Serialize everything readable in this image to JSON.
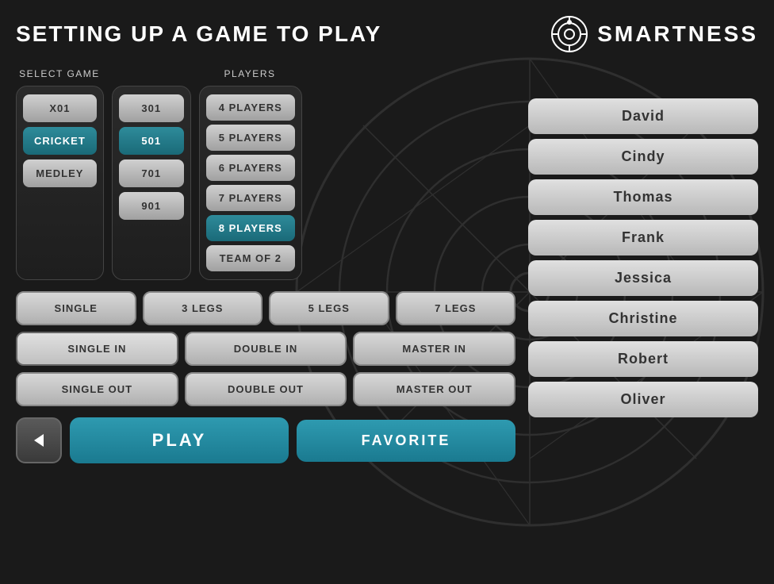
{
  "header": {
    "title": "SETTING UP A GAME TO PLAY",
    "logo_text": "SMARTNESS"
  },
  "select_game": {
    "label": "SELECT GAME",
    "game_types": [
      {
        "id": "x01",
        "label": "X01",
        "active": false
      },
      {
        "id": "cricket",
        "label": "CRICKET",
        "active": true
      },
      {
        "id": "medley",
        "label": "MEDLEY",
        "active": false
      }
    ],
    "scores": [
      {
        "id": "301",
        "label": "301",
        "active": false
      },
      {
        "id": "501",
        "label": "501",
        "active": true
      },
      {
        "id": "701",
        "label": "701",
        "active": false
      },
      {
        "id": "901",
        "label": "901",
        "active": false
      }
    ]
  },
  "players_section": {
    "label": "PLAYERS",
    "options": [
      {
        "id": "4players",
        "label": "4 PLAYERS",
        "active": false
      },
      {
        "id": "5players",
        "label": "5 PLAYERS",
        "active": false
      },
      {
        "id": "6players",
        "label": "6 PLAYERS",
        "active": false
      },
      {
        "id": "7players",
        "label": "7 PLAYERS",
        "active": false
      },
      {
        "id": "8players",
        "label": "8 PLAYERS",
        "active": true
      },
      {
        "id": "teamof2",
        "label": "TEAM OF 2",
        "active": false
      }
    ]
  },
  "leg_options": [
    {
      "id": "single",
      "label": "SINGLE",
      "active": false
    },
    {
      "id": "3legs",
      "label": "3 LEGS",
      "active": false
    },
    {
      "id": "5legs",
      "label": "5 LEGS",
      "active": false
    },
    {
      "id": "7legs",
      "label": "7 LEGS",
      "active": false
    }
  ],
  "in_options": [
    {
      "id": "singlein",
      "label": "SINGLE IN",
      "active": true
    },
    {
      "id": "doublein",
      "label": "DOUBLE IN",
      "active": false
    },
    {
      "id": "masterin",
      "label": "MASTER IN",
      "active": false
    }
  ],
  "out_options": [
    {
      "id": "singleout",
      "label": "SINGLE OUT",
      "active": false
    },
    {
      "id": "doubleout",
      "label": "DOUBLE OUT",
      "active": false
    },
    {
      "id": "masterout",
      "label": "MASTER OUT",
      "active": false
    }
  ],
  "action_buttons": {
    "back_label": "◀",
    "play_label": "PLAY",
    "favorite_label": "FAVORITE"
  },
  "player_names": [
    {
      "id": "david",
      "name": "David"
    },
    {
      "id": "cindy",
      "name": "Cindy"
    },
    {
      "id": "thomas",
      "name": "Thomas"
    },
    {
      "id": "frank",
      "name": "Frank"
    },
    {
      "id": "jessica",
      "name": "Jessica"
    },
    {
      "id": "christine",
      "name": "Christine"
    },
    {
      "id": "robert",
      "name": "Robert"
    },
    {
      "id": "oliver",
      "name": "Oliver"
    }
  ]
}
